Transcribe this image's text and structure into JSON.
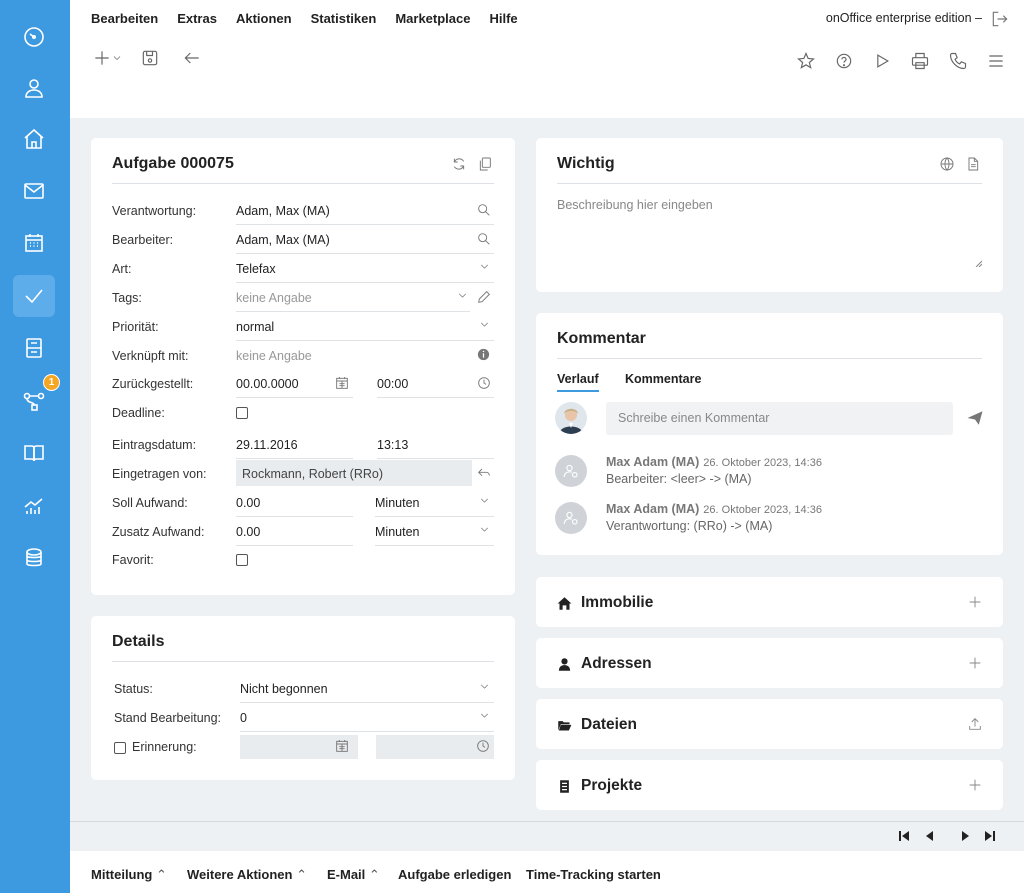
{
  "menu": [
    "Bearbeiten",
    "Extras",
    "Aktionen",
    "Statistiken",
    "Marketplace",
    "Hilfe"
  ],
  "edition": "onOffice enterprise edition  –",
  "sidebar": {
    "badge": "1"
  },
  "task": {
    "title": "Aufgabe 000075",
    "fields": {
      "verantwortung": {
        "label": "Verantwortung:",
        "value": "Adam, Max (MA)"
      },
      "bearbeiter": {
        "label": "Bearbeiter:",
        "value": "Adam, Max (MA)"
      },
      "art": {
        "label": "Art:",
        "value": "Telefax"
      },
      "tags": {
        "label": "Tags:",
        "value": "keine Angabe"
      },
      "prioritaet": {
        "label": "Priorität:",
        "value": "normal"
      },
      "verknuepft": {
        "label": "Verknüpft mit:",
        "value": "keine Angabe"
      },
      "zurueckgestellt": {
        "label": "Zurückgestellt:",
        "date": "00.00.0000",
        "time": "00:00"
      },
      "deadline": {
        "label": "Deadline:"
      },
      "eintragsdatum": {
        "label": "Eintragsdatum:",
        "date": "29.11.2016",
        "time": "13:13"
      },
      "eingetragen": {
        "label": "Eingetragen von:",
        "value": "Rockmann, Robert (RRo)"
      },
      "soll": {
        "label": "Soll Aufwand:",
        "value": "0.00",
        "unit": "Minuten"
      },
      "zusatz": {
        "label": "Zusatz Aufwand:",
        "value": "0.00",
        "unit": "Minuten"
      },
      "favorit": {
        "label": "Favorit:"
      }
    }
  },
  "details": {
    "title": "Details",
    "status": {
      "label": "Status:",
      "value": "Nicht begonnen"
    },
    "stand": {
      "label": "Stand Bearbeitung:",
      "value": "0"
    },
    "erinnerung": {
      "label": "Erinnerung:"
    }
  },
  "wichtig": {
    "title": "Wichtig",
    "placeholder": "Beschreibung hier eingeben"
  },
  "kommentar": {
    "title": "Kommentar",
    "tabs": [
      "Verlauf",
      "Kommentare"
    ],
    "input_placeholder": "Schreibe einen Kommentar",
    "history": [
      {
        "name": "Max Adam (MA)",
        "date": "26. Oktober 2023, 14:36",
        "text": "Bearbeiter: <leer> -> (MA)"
      },
      {
        "name": "Max Adam (MA)",
        "date": "26. Oktober 2023, 14:36",
        "text": "Verantwortung: (RRo) -> (MA)"
      }
    ]
  },
  "sections": {
    "immobilie": "Immobilie",
    "adressen": "Adressen",
    "dateien": "Dateien",
    "projekte": "Projekte"
  },
  "bottombar": {
    "mitteilung": "Mitteilung",
    "weitere": "Weitere Aktionen",
    "email": "E-Mail",
    "erledigen": "Aufgabe erledigen",
    "tracking": "Time-Tracking starten"
  }
}
